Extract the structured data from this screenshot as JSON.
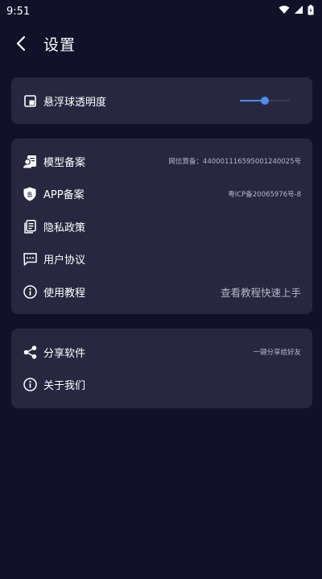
{
  "status_bar": {
    "time": "9:51"
  },
  "header": {
    "title": "设置"
  },
  "opacity_card": {
    "label": "悬浮球透明度",
    "slider_value": 0.5
  },
  "info_card": {
    "items": [
      {
        "label": "模型备案",
        "value": "网信算备：440001116595001240025号",
        "icon": "model-filing-icon"
      },
      {
        "label": "APP备案",
        "value": "粤ICP备20065976号-8",
        "icon": "app-filing-shield-icon"
      },
      {
        "label": "隐私政策",
        "value": "",
        "icon": "document-icon"
      },
      {
        "label": "用户协议",
        "value": "",
        "icon": "message-icon"
      },
      {
        "label": "使用教程",
        "value": "查看教程快速上手",
        "icon": "info-icon"
      }
    ]
  },
  "share_card": {
    "items": [
      {
        "label": "分享软件",
        "value": "一键分享给好友",
        "icon": "share-icon"
      },
      {
        "label": "关于我们",
        "value": "",
        "icon": "info-icon"
      }
    ]
  },
  "colors": {
    "background": "#11112a",
    "card": "#272840",
    "accent": "#4d8ef0"
  }
}
